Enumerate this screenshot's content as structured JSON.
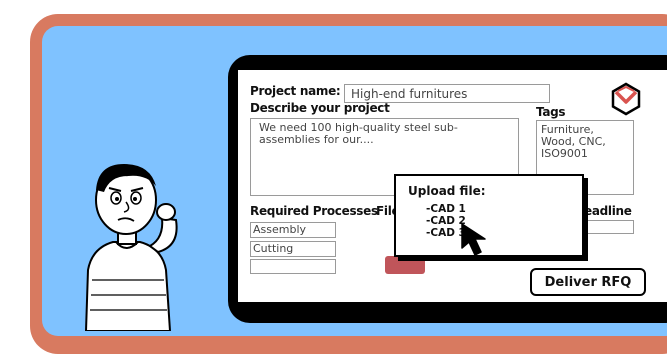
{
  "form": {
    "project_name_label": "Project name:",
    "project_name_value": "High-end furnitures",
    "describe_label": "Describe your project",
    "describe_value": "We need 100 high-quality steel sub-assemblies for our....",
    "tags_label": "Tags",
    "tags_value": "Furniture, Wood, CNC, ISO9001",
    "required_processes_label": "Required Processes",
    "process_1": "Assembly",
    "process_2": "Cutting",
    "process_3": "",
    "files_label": "Files",
    "deadline_label": "eadline",
    "deliver_button": "Deliver RFQ"
  },
  "upload_popup": {
    "title": "Upload file:",
    "options": [
      "-CAD 1",
      "-CAD 2",
      "-CAD 3"
    ]
  },
  "colors": {
    "frame": "#d87a60",
    "background": "#7fc2ff",
    "logo_red": "#d9534f",
    "button_red": "#c0555a"
  }
}
